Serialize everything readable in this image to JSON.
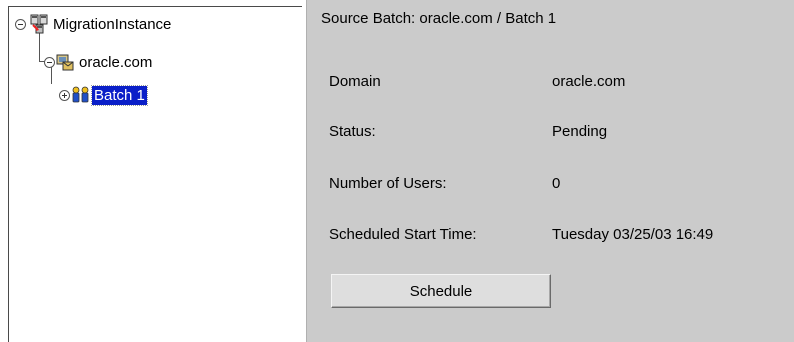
{
  "tree": {
    "items": [
      {
        "label": "MigrationInstance",
        "expanded": true,
        "icon": "server-instance-icon"
      },
      {
        "label": "oracle.com",
        "expanded": true,
        "icon": "domain-icon"
      },
      {
        "label": "Batch 1",
        "expanded": false,
        "icon": "users-group-icon",
        "selected": true
      }
    ]
  },
  "detail": {
    "header": "Source Batch: oracle.com / Batch  1",
    "fields": [
      {
        "label": "Domain",
        "value": "oracle.com"
      },
      {
        "label": "Status:",
        "value": "Pending"
      },
      {
        "label": "Number of Users:",
        "value": "0"
      },
      {
        "label": "Scheduled Start Time:",
        "value": "Tuesday 03/25/03 16:49"
      }
    ],
    "schedule_button": "Schedule"
  },
  "colors": {
    "selection": "#0a1fc8",
    "detail_background": "#cbcbcb"
  }
}
